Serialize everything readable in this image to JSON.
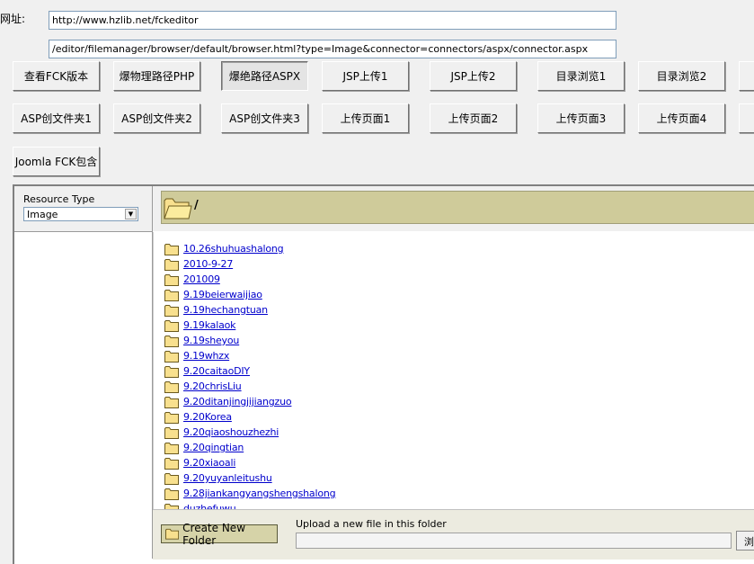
{
  "url_label": "网址:",
  "url_input_value": "http://www.hzlib.net/fckeditor",
  "path_input_value": "/editor/filemanager/browser/default/browser.html?type=Image&connector=connectors/aspx/connector.aspx",
  "buttons_row1": [
    "查看FCK版本",
    "爆物理路径PHP",
    "爆绝路径ASPX",
    "JSP上传1",
    "JSP上传2",
    "目录浏览1",
    "目录浏览2"
  ],
  "buttons_row2": [
    "ASP创文件夹1",
    "ASP创文件夹2",
    "ASP创文件夹3",
    "上传页面1",
    "上传页面2",
    "上传页面3",
    "上传页面4"
  ],
  "joomla_button": "Joomla FCK包含",
  "resource_type_label": "Resource Type",
  "resource_type_value": "Image",
  "current_path": "/",
  "folders": [
    "10.26shuhuashalong",
    "2010-9-27",
    "201009",
    "9.19beierwaijiao",
    "9.19hechangtuan",
    "9.19kalaok",
    "9.19sheyou",
    "9.19whzx",
    "9.20caitaoDIY",
    "9.20chrisLiu",
    "9.20ditanjingjijiangzuo",
    "9.20Korea",
    "9.20qiaoshouzhezhi",
    "9.20qingtian",
    "9.20xiaoali",
    "9.20yuyanleitushu",
    "9.28jiankangyangshengshalong",
    "duzhefuwu"
  ],
  "create_folder_label": "Create New Folder",
  "upload_label": "Upload a new file in this folder",
  "browse_label": "浏",
  "colors": {
    "path_bar": "#cfcb9a",
    "link": "#0000cc",
    "folder": "#f8e08e"
  }
}
